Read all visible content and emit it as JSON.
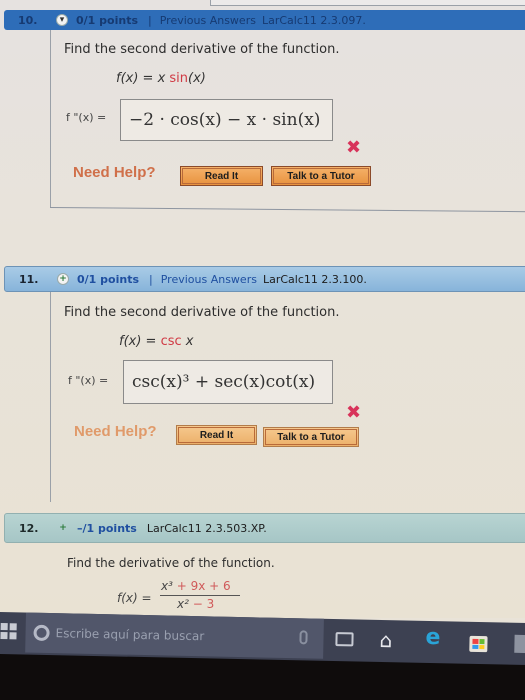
{
  "questions": [
    {
      "number": "10.",
      "toggle_icon": "collapse-arrow-icon",
      "points": "0/1 points",
      "separator": "|",
      "previous_answers": "Previous Answers",
      "reference": "LarCalc11 2.3.097.",
      "prompt": "Find the second derivative of the function.",
      "function_lhs": "f(x) = ",
      "function_parts": [
        {
          "text": "x ",
          "color": "normal"
        },
        {
          "text": "sin",
          "color": "red"
        },
        {
          "text": "(x)",
          "color": "normal"
        }
      ],
      "answer_label": "f \"(x) = ",
      "answer_value": "−2 · cos(x) − x · sin(x)",
      "result": "incorrect",
      "need_help": "Need Help?",
      "buttons": [
        "Read It",
        "Talk to a Tutor"
      ]
    },
    {
      "number": "11.",
      "toggle_icon": "expand-plus-icon",
      "points": "0/1 points",
      "separator": "|",
      "previous_answers": "Previous Answers",
      "reference": "LarCalc11 2.3.100.",
      "prompt": "Find the second derivative of the function.",
      "function_lhs": "f(x) = ",
      "function_parts": [
        {
          "text": "csc",
          "color": "red"
        },
        {
          "text": " x",
          "color": "normal"
        }
      ],
      "answer_label": "f \"(x) = ",
      "answer_value": "csc(x)³ + sec(x)cot(x)",
      "result": "incorrect",
      "need_help": "Need Help?",
      "buttons": [
        "Read It",
        "Talk to a Tutor"
      ]
    },
    {
      "number": "12.",
      "toggle_icon": "expand-plus-icon",
      "points": "–/1 points",
      "reference": "LarCalc11 2.3.503.XP.",
      "prompt": "Find the derivative of the function.",
      "function_lhs": "f(x) = ",
      "numerator": {
        "lead": "x³",
        "rest": " + 9x + 6"
      },
      "denominator": {
        "lead": "x²",
        "rest": " − 3"
      }
    }
  ],
  "taskbar": {
    "search_placeholder": "Escribe aquí para buscar",
    "icons": [
      "windows-start-icon",
      "cortana-icon",
      "microphone-icon",
      "task-view-icon",
      "home-icon",
      "edge-browser-icon",
      "store-icon"
    ]
  },
  "colors": {
    "header_q10": "#2e6db8",
    "header_q11": "#9bc0e0",
    "header_q12": "#b0cccb",
    "wrong_mark": "#d8335a",
    "need_help": "#d0704a",
    "help_button": "#ee9f50",
    "taskbar": "#3d4152"
  }
}
